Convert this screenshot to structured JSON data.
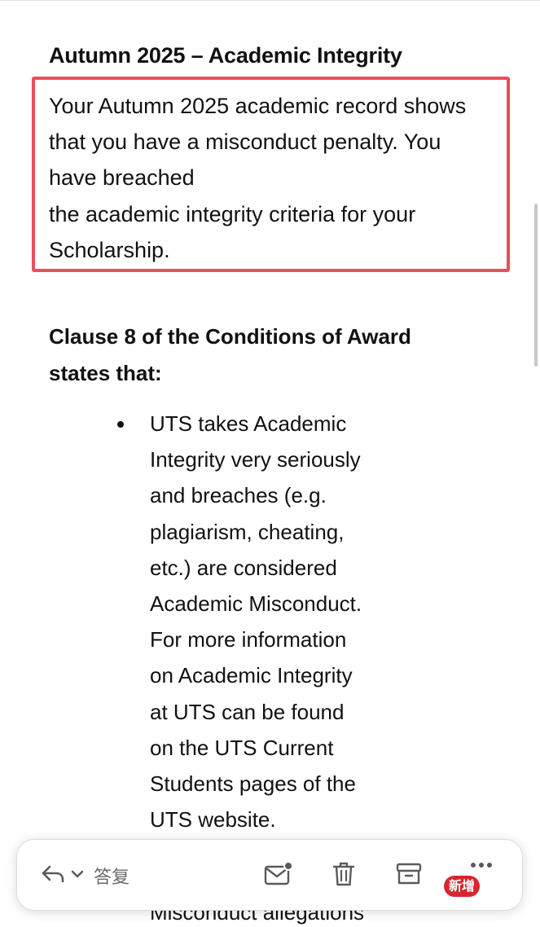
{
  "email": {
    "heading": "Autumn 2025 – Academic Integrity",
    "highlighted_paragraph": [
      "Your Autumn 2025 academic record shows",
      "that you have a misconduct penalty. You",
      "have breached",
      "the academic integrity criteria for your",
      "Scholarship."
    ],
    "clause_heading": [
      "Clause 8 of the Conditions of Award",
      "states that:"
    ],
    "bullet_lines": [
      "UTS takes Academic",
      "Integrity very seriously",
      "and breaches (e.g.",
      "plagiarism, cheating,",
      "etc.) are considered",
      "Academic Misconduct.",
      "For more information",
      "on Academic Integrity",
      "at UTS can be found",
      "on the UTS Current",
      "Students pages of the",
      "UTS website."
    ],
    "cutoff_line": "Misconduct allegations"
  },
  "toolbar": {
    "reply_label": "答复",
    "new_badge": "新增",
    "icons": [
      "reply-icon",
      "chevron-down-icon",
      "mail-unread-icon",
      "trash-icon",
      "archive-icon",
      "more-icon"
    ]
  },
  "colors": {
    "highlight_border": "#e8505b",
    "badge": "#d7262f"
  }
}
